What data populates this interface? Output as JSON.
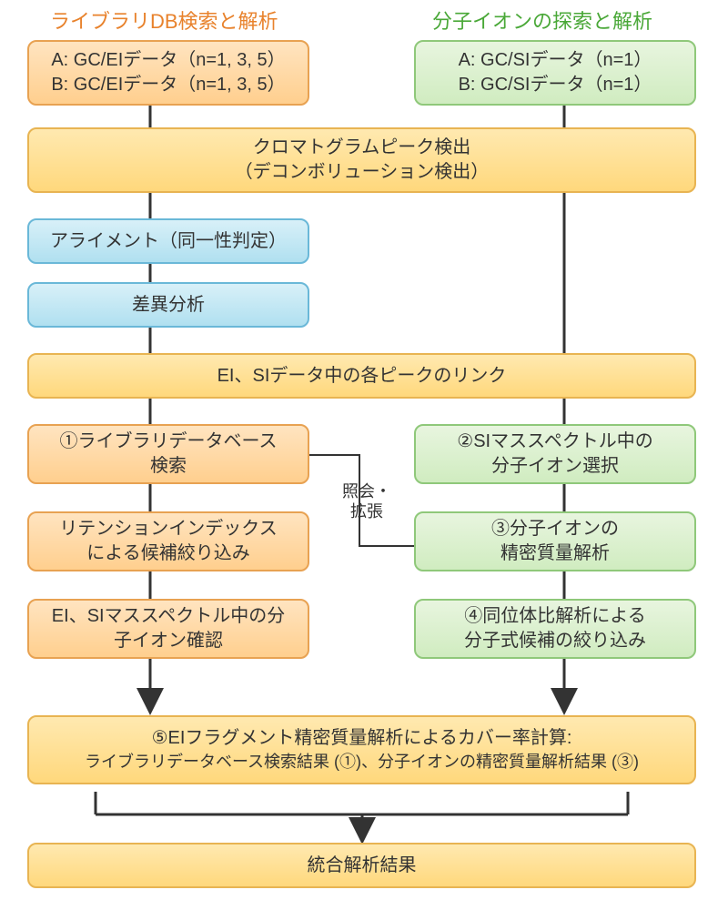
{
  "headers": {
    "left": "ライブラリDB検索と解析",
    "right": "分子イオンの探索と解析"
  },
  "boxes": {
    "ei_data_a": "A: GC/EIデータ（n=1, 3, 5）",
    "ei_data_b": "B: GC/EIデータ（n=1, 3, 5）",
    "si_data_a": "A: GC/SIデータ（n=1）",
    "si_data_b": "B: GC/SIデータ（n=1）",
    "chromatogram_l1": "クロマトグラムピーク検出",
    "chromatogram_l2": "（デコンボリューション検出）",
    "alignment": "アライメント（同一性判定）",
    "diff": "差異分析",
    "link": "EI、SIデータ中の各ピークのリンク",
    "lib_search_l1": "①ライブラリデータベース",
    "lib_search_l2": "検索",
    "retention_l1": "リテンションインデックス",
    "retention_l2": "による候補絞り込み",
    "ei_si_ion_l1": "EI、SIマススペクトル中の分",
    "ei_si_ion_l2": "子イオン確認",
    "si_mass_l1": "②SIマススペクトル中の",
    "si_mass_l2": "分子イオン選択",
    "mol_ion_l1": "③分子イオンの",
    "mol_ion_l2": "精密質量解析",
    "isotope_l1": "④同位体比解析による",
    "isotope_l2": "分子式候補の絞り込み",
    "fragment_l1": "⑤EIフラグメント精密質量解析によるカバー率計算:",
    "fragment_l2": "ライブラリデータベース検索結果 (①)、分子イオンの精密質量解析結果 (③)",
    "result": "統合解析結果"
  },
  "annotations": {
    "shoukai_l1": "照会・",
    "shoukai_l2": "拡張"
  }
}
